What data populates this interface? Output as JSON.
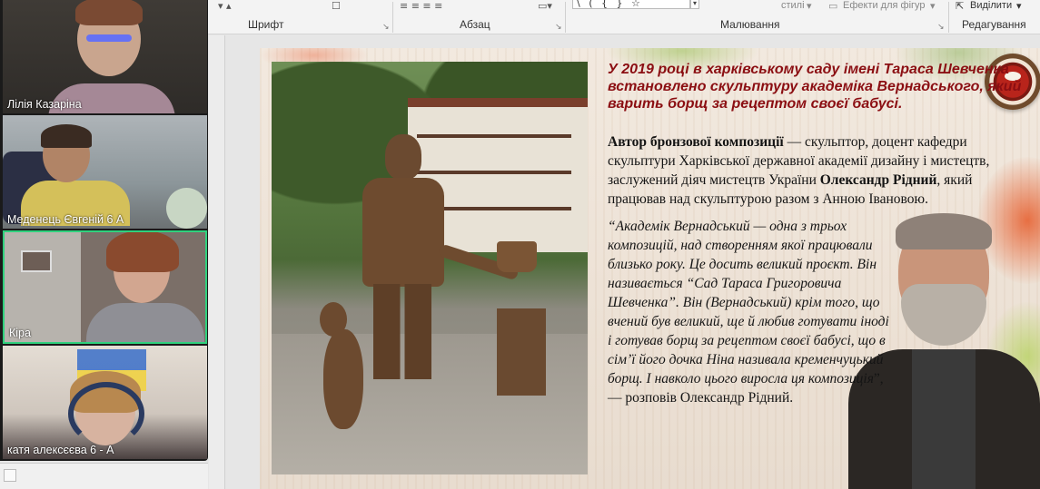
{
  "ribbon": {
    "group_font": "Шрифт",
    "group_paragraph": "Абзац",
    "group_drawing": "Малювання",
    "group_editing": "Редагування",
    "styles_label": "стилі",
    "shape_effects_label": "Ефекти для фігур",
    "select_label": "Виділити",
    "shape_gallery_glyphs": "\\ ( { } ☆"
  },
  "participants": [
    {
      "name": "Лілія Казаріна",
      "active": false
    },
    {
      "name": "Меденець Євгеній 6 А",
      "active": false
    },
    {
      "name": "Кіра",
      "active": true
    },
    {
      "name": "катя алексєєва 6 - А",
      "active": false
    }
  ],
  "slide": {
    "heading": "У 2019 році в харківському саду імені Тараса Шевченка встановлено скульптуру академіка Вернадського, який варить борщ за рецептом своєї бабусі.",
    "para_bold1": "Автор бронзової композиції",
    "para_text1": " — скульптор, доцент кафедри скульптури Харківської державної академії дизайну і мистецтв, заслужений діяч мистецтв України ",
    "para_bold2": "Олександр Рідний",
    "para_text2": ", який працював над скульптурою разом з Анною Івановою.",
    "quote_italic": "“Академік Вернадський — одна з трьох композицій, над створенням якої працювали близько року. Це досить великий проєкт. Він називається “Сад Тараса Григоровича Шевченка”. Він (Вернадський) крім того, що вчений був великий, ще й любив готувати іноді і готував борщ за рецептом своєї бабусі, що в сім’ї його дочка Ніна називала кременчуцький борщ. І навколо цього виросла ця композиція",
    "quote_plain": "”, — розповів Олександр Рідний."
  },
  "colors": {
    "heading": "#8b0e12",
    "active_tile_border": "#2fd17d"
  }
}
